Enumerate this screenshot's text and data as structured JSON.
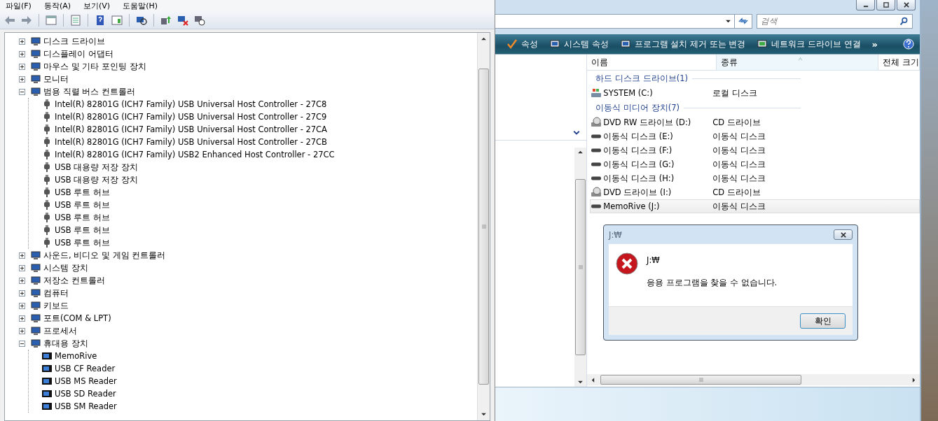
{
  "device_manager": {
    "menu": [
      "파일(F)",
      "동작(A)",
      "보기(V)",
      "도움말(H)"
    ],
    "tree": [
      {
        "label": "디스크 드라이브",
        "expanded": false
      },
      {
        "label": "디스플레이 어댑터",
        "expanded": false
      },
      {
        "label": "마우스 및 기타 포인팅 장치",
        "expanded": false
      },
      {
        "label": "모니터",
        "expanded": false
      },
      {
        "label": "범용 직렬 버스 컨트롤러",
        "expanded": true,
        "children": [
          {
            "label": "Intel(R) 82801G (ICH7 Family) USB Universal Host Controller - 27C8"
          },
          {
            "label": "Intel(R) 82801G (ICH7 Family) USB Universal Host Controller - 27C9"
          },
          {
            "label": "Intel(R) 82801G (ICH7 Family) USB Universal Host Controller - 27CA"
          },
          {
            "label": "Intel(R) 82801G (ICH7 Family) USB Universal Host Controller - 27CB"
          },
          {
            "label": "Intel(R) 82801G (ICH7 Family) USB2 Enhanced Host Controller - 27CC"
          },
          {
            "label": "USB 대용량 저장 장치"
          },
          {
            "label": "USB 대용량 저장 장치"
          },
          {
            "label": "USB 루트 허브"
          },
          {
            "label": "USB 루트 허브"
          },
          {
            "label": "USB 루트 허브"
          },
          {
            "label": "USB 루트 허브"
          },
          {
            "label": "USB 루트 허브"
          }
        ]
      },
      {
        "label": "사운드, 비디오 및 게임 컨트롤러",
        "expanded": false
      },
      {
        "label": "시스템 장치",
        "expanded": false
      },
      {
        "label": "저장소 컨트롤러",
        "expanded": false
      },
      {
        "label": "컴퓨터",
        "expanded": false
      },
      {
        "label": "키보드",
        "expanded": false
      },
      {
        "label": "포트(COM & LPT)",
        "expanded": false
      },
      {
        "label": "프로세서",
        "expanded": false
      },
      {
        "label": "휴대용 장치",
        "expanded": true,
        "children": [
          {
            "label": "MemoRive"
          },
          {
            "label": "USB CF Reader"
          },
          {
            "label": "USB MS Reader"
          },
          {
            "label": "USB SD Reader"
          },
          {
            "label": "USB SM Reader"
          }
        ]
      }
    ]
  },
  "explorer": {
    "search": {
      "placeholder": "검색"
    },
    "commands": [
      "속성",
      "시스템 속성",
      "프로그램 설치 제거 또는 변경",
      "네트워크 드라이브 연결"
    ],
    "overflow": "»",
    "columns": [
      {
        "label": "이름",
        "sorted": false
      },
      {
        "label": "종류",
        "sorted": true
      },
      {
        "label": "전체 크기",
        "sorted": false
      }
    ],
    "groups": [
      {
        "title": "하드 디스크 드라이브(1)",
        "items": [
          {
            "name": "SYSTEM (C:)",
            "type": "로컬 디스크",
            "kind": "system",
            "selected": false
          }
        ]
      },
      {
        "title": "이동식 미디어 장치(7)",
        "items": [
          {
            "name": "DVD RW 드라이브 (D:)",
            "type": "CD 드라이브",
            "kind": "optical",
            "selected": false
          },
          {
            "name": "이동식 디스크 (E:)",
            "type": "이동식 디스크",
            "kind": "removable",
            "selected": false
          },
          {
            "name": "이동식 디스크 (F:)",
            "type": "이동식 디스크",
            "kind": "removable",
            "selected": false
          },
          {
            "name": "이동식 디스크 (G:)",
            "type": "이동식 디스크",
            "kind": "removable",
            "selected": false
          },
          {
            "name": "이동식 디스크 (H:)",
            "type": "이동식 디스크",
            "kind": "removable",
            "selected": false
          },
          {
            "name": "DVD 드라이브 (I:)",
            "type": "CD 드라이브",
            "kind": "optical",
            "selected": false
          },
          {
            "name": "MemoRive (J:)",
            "type": "이동식 디스크",
            "kind": "removable",
            "selected": true
          }
        ]
      }
    ]
  },
  "dialog": {
    "title": "J:₩",
    "heading": "J:₩",
    "message": "응용 프로그램을 찾을 수 없습니다.",
    "button": "확인"
  }
}
